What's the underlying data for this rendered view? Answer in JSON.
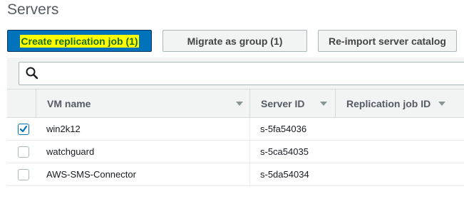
{
  "page": {
    "title": "Servers"
  },
  "toolbar": {
    "create_label": "Create replication job (1)",
    "migrate_label": "Migrate as group (1)",
    "reimport_label": "Re-import server catalog"
  },
  "search": {
    "placeholder": "",
    "value": ""
  },
  "table": {
    "columns": [
      "VM name",
      "Server ID",
      "Replication job ID"
    ],
    "rows": [
      {
        "name": "win2k12",
        "server_id": "s-5fa54036",
        "job_id": "",
        "selected": true
      },
      {
        "name": "watchguard",
        "server_id": "s-5ca54035",
        "job_id": "",
        "selected": false
      },
      {
        "name": "AWS-SMS-Connector",
        "server_id": "s-5da54034",
        "job_id": "",
        "selected": false
      }
    ]
  },
  "icons": {
    "search": "search-icon",
    "sort": "caret-down-icon",
    "check": "checkmark-icon"
  },
  "colors": {
    "primary": "#0073bb",
    "highlight": "#ffff00",
    "header_bg": "#f2f3f3"
  }
}
